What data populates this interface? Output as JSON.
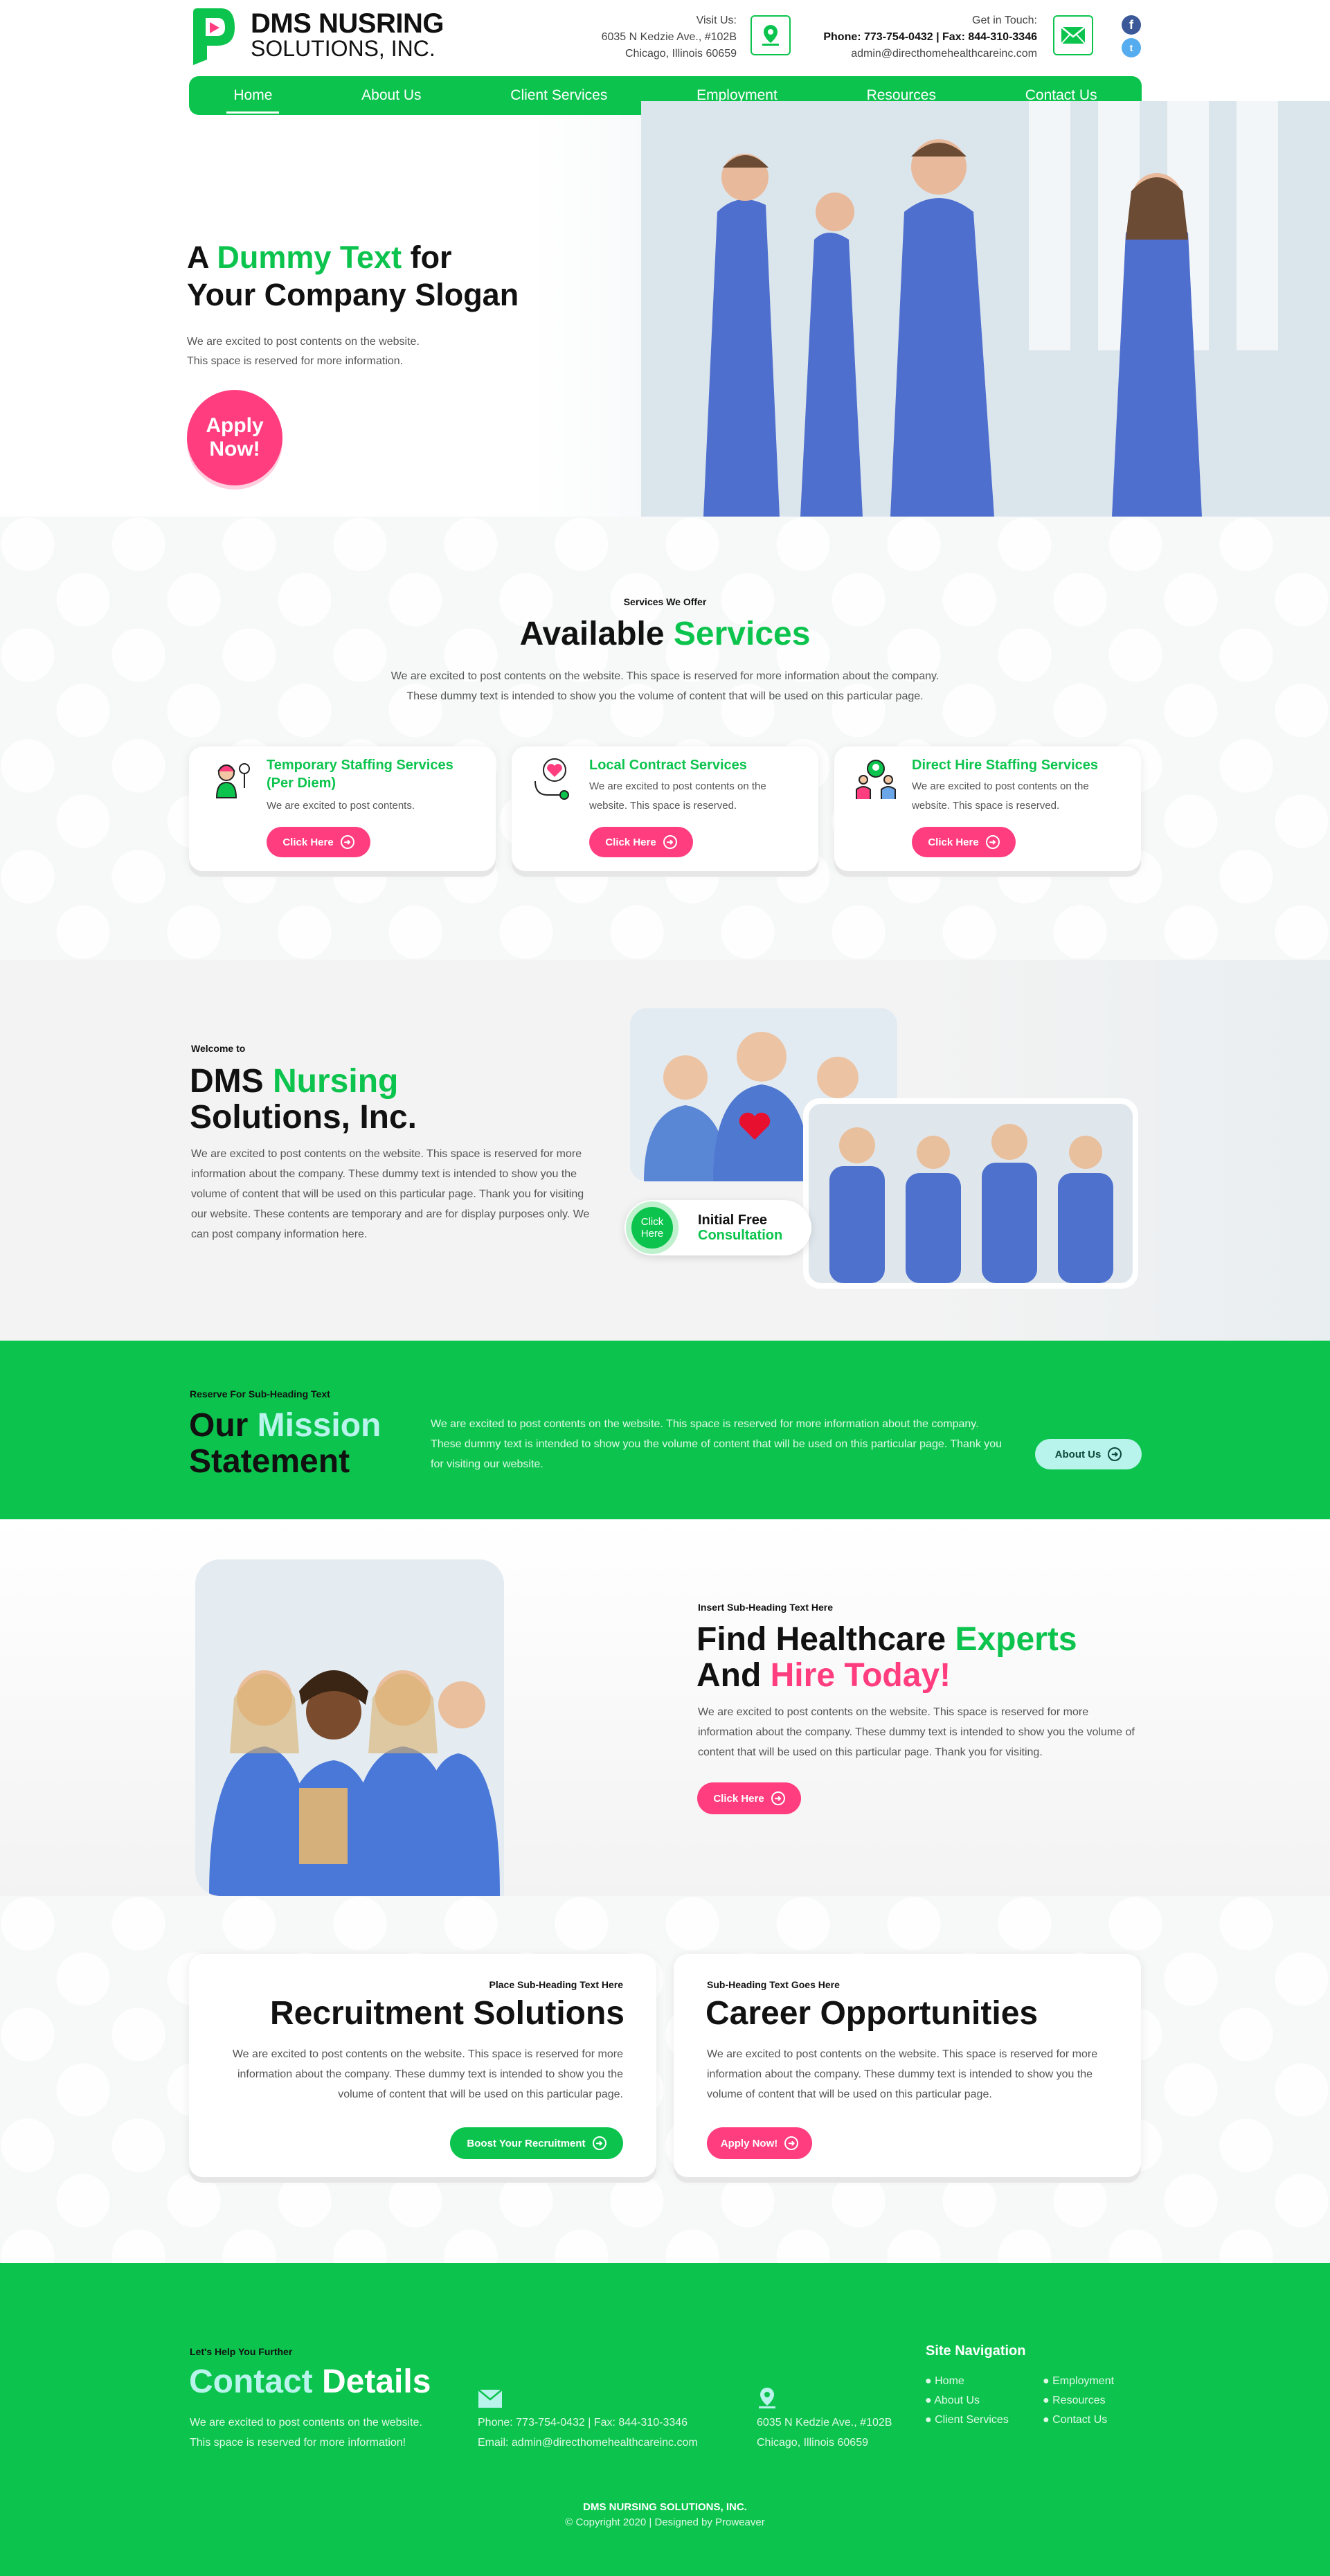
{
  "header": {
    "logo_line1": "DMS NUSRING",
    "logo_line2": "SOLUTIONS, INC.",
    "visit_label": "Visit Us:",
    "address1": "6035 N Kedzie Ave., #102B",
    "address2": "Chicago, Illinois 60659",
    "touch_label": "Get in Touch:",
    "phone_fax": "Phone: 773-754-0432 | Fax: 844-310-3346",
    "email": "admin@directhomehealthcareinc.com",
    "social": [
      {
        "icon": "facebook-icon",
        "glyph": "f",
        "color": "#3b5998"
      },
      {
        "icon": "twitter-icon",
        "glyph": "t",
        "color": "#55acee"
      }
    ]
  },
  "nav": [
    {
      "label": "Home"
    },
    {
      "label": "About Us"
    },
    {
      "label": "Client Services"
    },
    {
      "label": "Employment"
    },
    {
      "label": "Resources"
    },
    {
      "label": "Contact Us"
    }
  ],
  "hero": {
    "t1": "A ",
    "t2": "Dummy Text",
    "t3": " for",
    "t4": "Your Company Slogan",
    "p1": "We are excited to post contents on the website.",
    "p2": "This space is reserved for more information.",
    "apply1": "Apply",
    "apply2": "Now!"
  },
  "services": {
    "sub": "Services We Offer",
    "h1": "Available ",
    "h2": "Services",
    "p1": "We are excited to post contents on the website. This space is reserved for more information about the company.",
    "p2": "These dummy text is intended to show you the volume of content that will be used on this particular page.",
    "cards": [
      {
        "icon": "nurse-icon",
        "title": "Temporary Staffing Services (Per Diem)",
        "text": "We are excited to post contents.",
        "btn": "Click Here"
      },
      {
        "icon": "stethoscope-heart-icon",
        "title": "Local Contract Services",
        "text": "We are excited to post contents on the website. This space is reserved.",
        "btn": "Click Here"
      },
      {
        "icon": "staff-group-icon",
        "title": "Direct Hire Staffing Services",
        "text": "We are excited to post contents on the website. This space is reserved.",
        "btn": "Click Here"
      }
    ]
  },
  "welcome": {
    "sub": "Welcome to",
    "h1": "DMS ",
    "h2": "Nursing",
    "h3": "Solutions, Inc.",
    "p": "We are excited to post contents on the website. This space is reserved for more information about the company. These dummy text is intended to show you the volume of content that will be used on this particular page. Thank you for visiting our website. These contents are temporary and are for display purposes only. We can post company information here.",
    "click1": "Click",
    "click2": "Here",
    "cons1": "Initial Free",
    "cons2": "Consultation"
  },
  "mission": {
    "sub": "Reserve For Sub-Heading Text",
    "h1": "Our ",
    "h2": "Mission",
    "h3": "Statement",
    "p": "We are excited to post contents on the website. This space is reserved for more information about the company. These dummy text is intended to show you the volume of content that will be used on this particular page. Thank you for visiting our website.",
    "btn": "About Us"
  },
  "find": {
    "sub": "Insert Sub-Heading Text Here",
    "h1": "Find Healthcare ",
    "h2": "Experts",
    "h3": "And ",
    "h4": "Hire Today!",
    "p": "We are excited to post contents on the website. This space is reserved for more information about the company. These dummy text is intended to show you the volume of content that will be used on this particular page. Thank you for visiting.",
    "btn": "Click Here"
  },
  "recruit": {
    "sub": "Place Sub-Heading Text Here",
    "h": "Recruitment Solutions",
    "p": "We are excited to post contents on the website. This space is reserved for more information about the company. These dummy text is intended to show you the volume of content that will be used on this particular page.",
    "btn": "Boost Your Recruitment"
  },
  "career": {
    "sub": "Sub-Heading Text Goes Here",
    "h": "Career Opportunities",
    "p": "We are excited to post contents on the website. This space is reserved for more information about the company. These dummy text is intended to show you the volume of content that will be used on this particular page.",
    "btn": "Apply Now!"
  },
  "footer": {
    "sub": "Let's Help You Further",
    "h1": "Contact ",
    "h2": "Details",
    "p1": "We are excited to post contents on the website.",
    "p2": "This space is reserved for more information!",
    "phone": "Phone: 773-754-0432 | Fax: 844-310-3346",
    "email": "Email: admin@directhomehealthcareinc.com",
    "addr1": "6035 N Kedzie Ave., #102B",
    "addr2": "Chicago, Illinois 60659",
    "nav_title": "Site Navigation",
    "nav": [
      "Home",
      "About Us",
      "Client Services",
      "Employment",
      "Resources",
      "Contact Us"
    ],
    "company": "DMS NURSING SOLUTIONS, INC.",
    "copy": "© Copyright 2020 | Designed by Proweaver"
  },
  "colors": {
    "green": "#0cc44d",
    "pink": "#ff3d7f",
    "teal": "#b8f3ec"
  }
}
